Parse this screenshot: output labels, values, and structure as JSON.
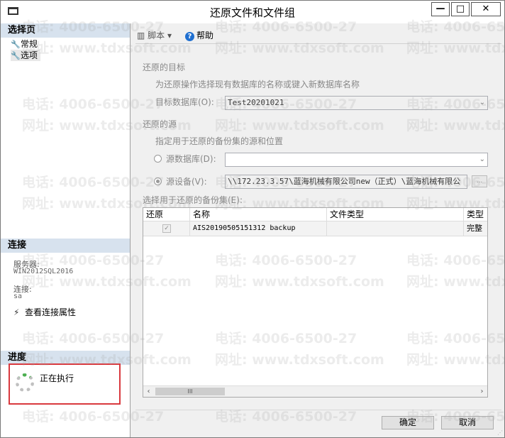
{
  "window": {
    "title": "还原文件和文件组",
    "controls": {
      "minimize": "—",
      "maximize": "□",
      "close": "✕"
    }
  },
  "left": {
    "select_page_header": "选择页",
    "pages": [
      {
        "label": "常规",
        "icon": "wrench-icon"
      },
      {
        "label": "选项",
        "icon": "wrench-icon"
      }
    ],
    "connection_header": "连接",
    "server_label": "服务器:",
    "server_value": "WIN2012SQL2016",
    "connection_label": "连接:",
    "connection_value": "sa",
    "view_connection_props": "查看连接属性",
    "progress_header": "进度",
    "progress_status": "正在执行"
  },
  "toolbar": {
    "script_label": "脚本",
    "help_label": "帮助"
  },
  "form": {
    "restore_target_heading": "还原的目标",
    "restore_target_hint": "为还原操作选择现有数据库的名称或键入新数据库名称",
    "target_db_label": "目标数据库(O):",
    "target_db_value": "Test20201021",
    "restore_source_heading": "还原的源",
    "restore_source_hint": "指定用于还原的备份集的源和位置",
    "source_db_label": "源数据库(D):",
    "source_db_value": "",
    "source_device_label": "源设备(V):",
    "source_device_value": "\\\\172.23.3.57\\蓝海机械有限公司new（正式）\\蓝海机械有限公",
    "browse_label": "...",
    "backup_sets_label": "选择用于还原的备份集(E):"
  },
  "grid": {
    "columns": [
      "还原",
      "名称",
      "文件类型",
      "类型"
    ],
    "rows": [
      {
        "restore": true,
        "name": "AIS20190505151312 backup",
        "file_type": "",
        "type": "完整"
      }
    ],
    "scroll_thumb": "III"
  },
  "buttons": {
    "ok": "确定",
    "cancel": "取消"
  },
  "watermark": {
    "phone": "电话: 4006-6500-27",
    "site": "网址: www.tdxsoft.com"
  }
}
